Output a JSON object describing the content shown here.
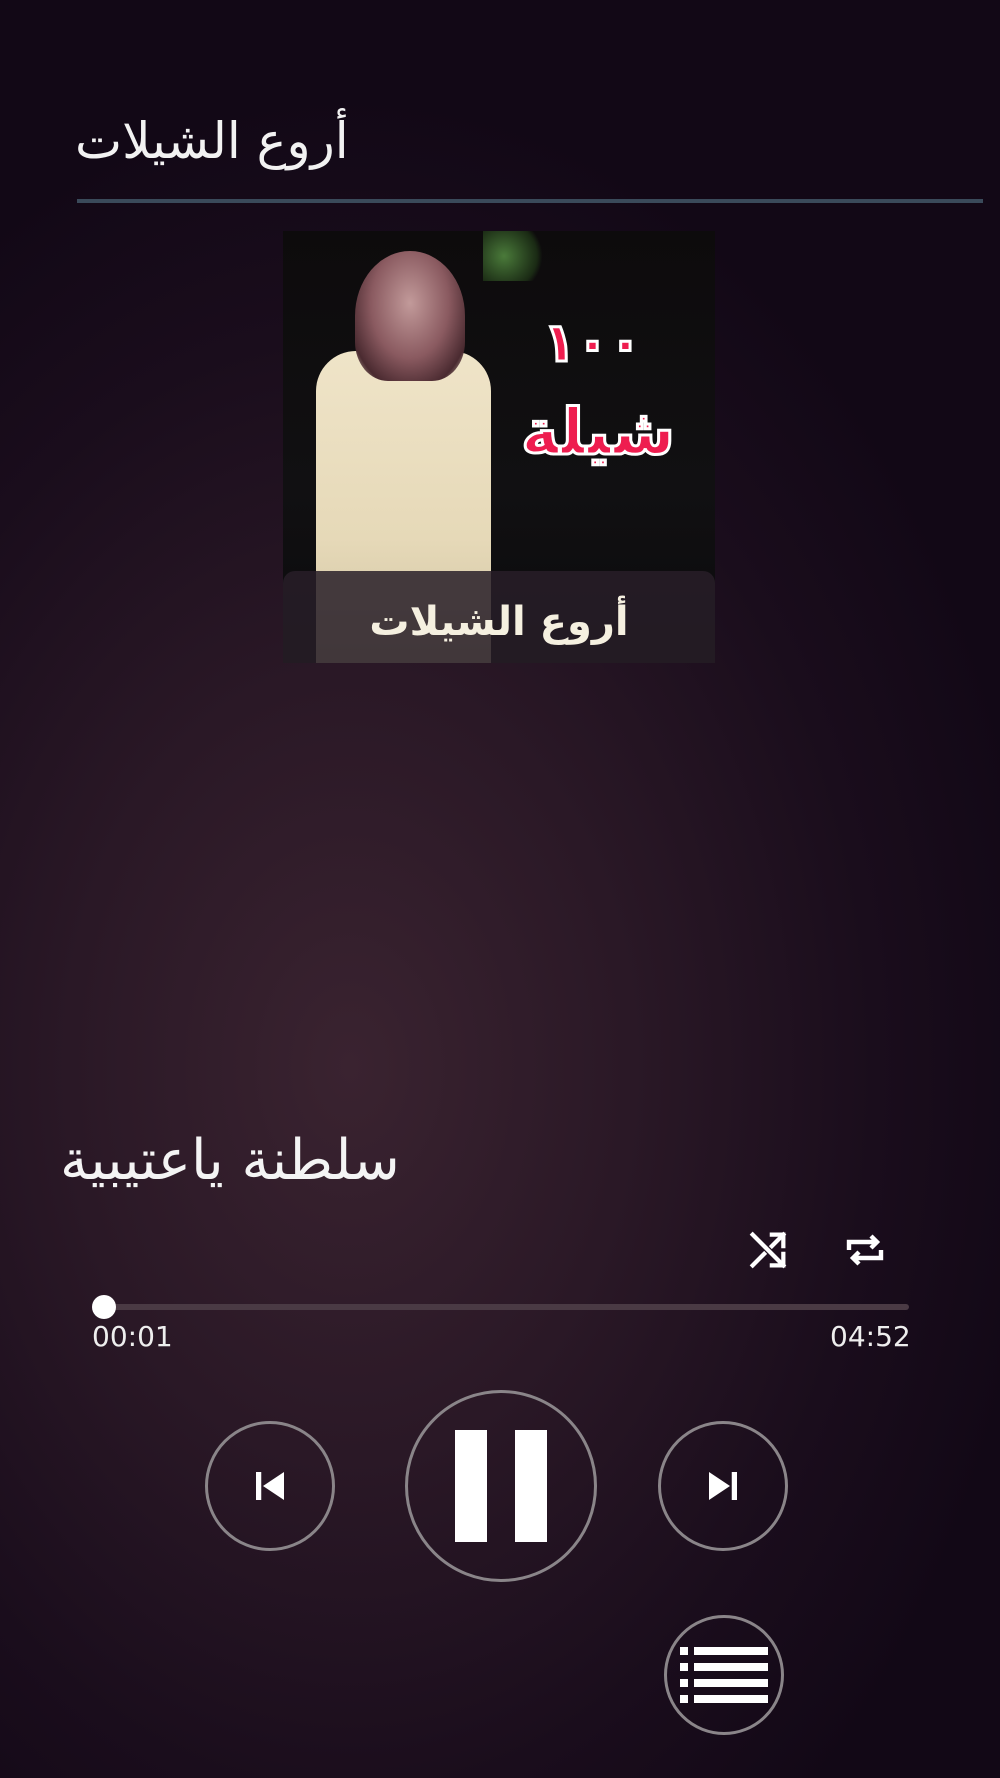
{
  "header": {
    "title": "أروع الشيلات"
  },
  "album_art": {
    "badge_count": "١٠٠",
    "badge_word": "شيلة",
    "caption": "أروع الشيلات"
  },
  "track": {
    "title": "سلطنة ياعتيبية"
  },
  "progress": {
    "elapsed": "00:01",
    "total": "04:52",
    "fraction": 0.0034
  },
  "icons": {
    "shuffle": "shuffle-icon",
    "repeat": "repeat-icon",
    "previous": "skip-previous-icon",
    "pause": "pause-icon",
    "next": "skip-next-icon",
    "playlist": "playlist-icon"
  },
  "colors": {
    "accent_badge": "#ee1d4f",
    "divider": "#3a4a5a",
    "button_ring": "#8a8589"
  }
}
